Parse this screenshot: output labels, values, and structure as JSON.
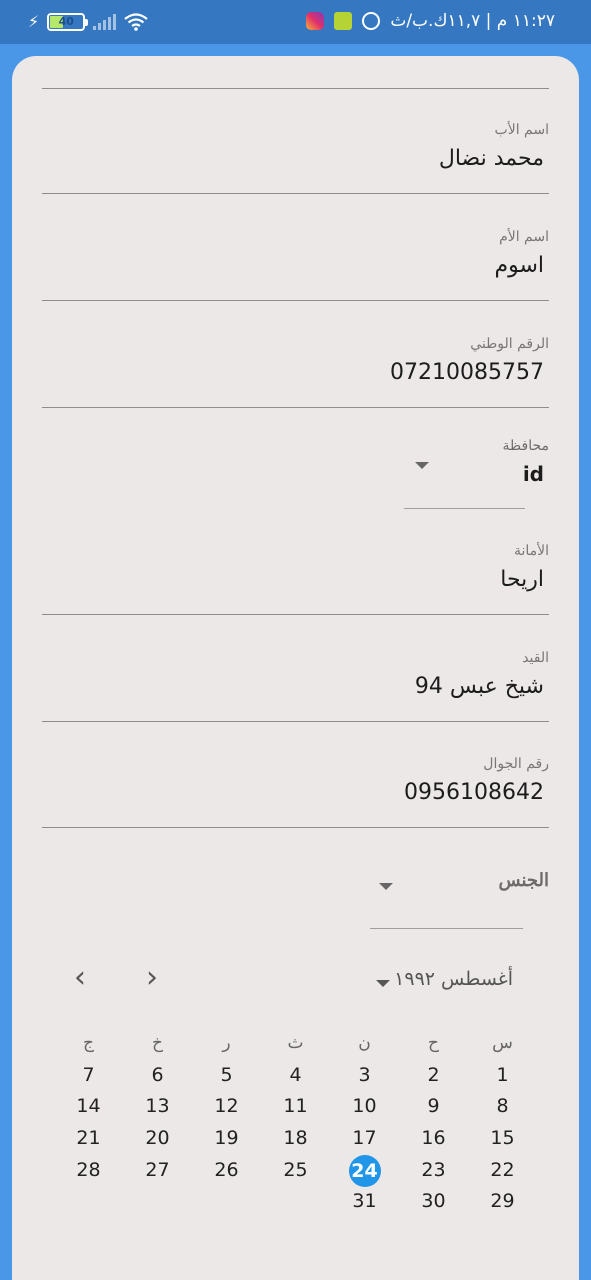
{
  "status_bar": {
    "battery": "40",
    "battery_level": 0.4,
    "time_text": "١١:٢٧ م | ١١,٧ك.ب/ث"
  },
  "form": {
    "father_name": {
      "label": "اسم الأب",
      "value": "محمد نضال"
    },
    "mother_name": {
      "label": "اسم الأم",
      "value": "اسوم"
    },
    "national_id": {
      "label": "الرقم الوطني",
      "value": "07210085757"
    },
    "governorate": {
      "label": "محافظة",
      "value": "id"
    },
    "amana": {
      "label": "الأمانة",
      "value": "اريحا"
    },
    "registry": {
      "label": "القيد",
      "value": "شيخ عبس 94"
    },
    "mobile": {
      "label": "رقم الجوال",
      "value": "0956108642"
    },
    "gender": {
      "label": "الجنس"
    }
  },
  "calendar": {
    "month_label": "أغسطس ١٩٩٢",
    "prev_icon": "‹",
    "next_icon": "›",
    "weekdays": [
      "س",
      "ح",
      "ن",
      "ث",
      "ر",
      "خ",
      "ج"
    ],
    "weeks": [
      [
        "1",
        "2",
        "3",
        "4",
        "5",
        "6",
        "7"
      ],
      [
        "8",
        "9",
        "10",
        "11",
        "12",
        "13",
        "14"
      ],
      [
        "15",
        "16",
        "17",
        "18",
        "19",
        "20",
        "21"
      ],
      [
        "22",
        "23",
        "24",
        "25",
        "26",
        "27",
        "28"
      ],
      [
        "29",
        "30",
        "31",
        "",
        "",
        "",
        ""
      ]
    ],
    "selected_day": "24",
    "accent_color": "#2196e8"
  }
}
